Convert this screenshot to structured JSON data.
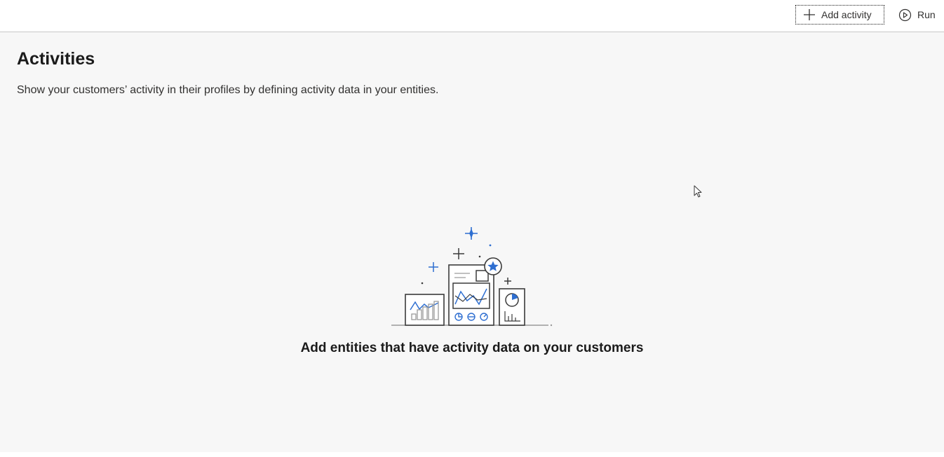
{
  "toolbar": {
    "add_activity_label": "Add activity",
    "add_activity_icon": "plus-icon",
    "run_label": "Run",
    "run_icon": "play-circle-icon"
  },
  "page": {
    "title": "Activities",
    "description": "Show your customers’ activity in their profiles by defining activity data in your entities."
  },
  "empty_state": {
    "illustration_icon": "dashboard-charts-illustration",
    "message": "Add entities that have activity data on your customers"
  },
  "colors": {
    "accent": "#2f6fd1",
    "line": "#3b3b3b",
    "background": "#f7f7f7",
    "toolbar_background": "#ffffff"
  }
}
